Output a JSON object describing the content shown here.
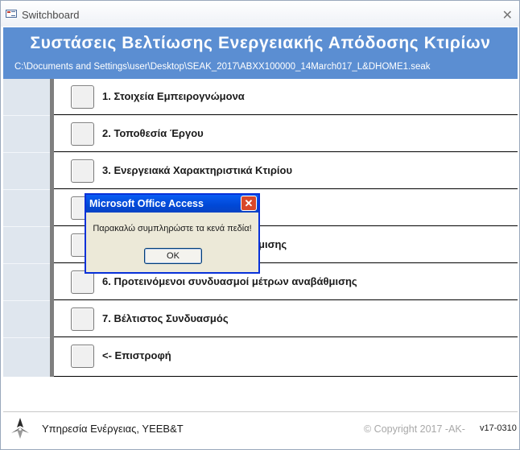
{
  "window": {
    "title": "Switchboard",
    "close_glyph": "✕"
  },
  "header": {
    "title": "Συστάσεις Βελτίωσης Ενεργειακής Απόδοσης Κτιρίων",
    "path": "C:\\Documents and Settings\\user\\Desktop\\SEAK_2017\\ABXX100000_14March017_L&DHOME1.seak"
  },
  "menu": {
    "items": [
      {
        "label": "1. Στοιχεία Εμπειρογνώμονα"
      },
      {
        "label": "2. Τοποθεσία Έργου"
      },
      {
        "label": "3. Ενεργειακά Χαρακτηριστικά Κτιρίου"
      },
      {
        "label": ""
      },
      {
        "label": "μισης"
      },
      {
        "label": "6. Προτεινόμενοι συνδυασμοί μέτρων αναβάθμισης"
      },
      {
        "label": "7. Βέλτιστος Συνδυασμός"
      },
      {
        "label": "<- Επιστροφή"
      }
    ]
  },
  "footer": {
    "org": "Υπηρεσία Ενέργειας, ΥΕΕΒ&Τ",
    "copyright": "© Copyright 2017 -AK-",
    "version": "v17-0310"
  },
  "dialog": {
    "title": "Microsoft Office Access",
    "message": "Παρακαλώ συμπληρώστε τα κενά πεδία!",
    "ok_label": "OK",
    "close_glyph": "✕"
  },
  "colors": {
    "header_bg": "#5b8ed2",
    "dialog_title_bg": "#0a5df3"
  },
  "icons": [
    "app-icon",
    "close-icon",
    "logo-icon"
  ]
}
